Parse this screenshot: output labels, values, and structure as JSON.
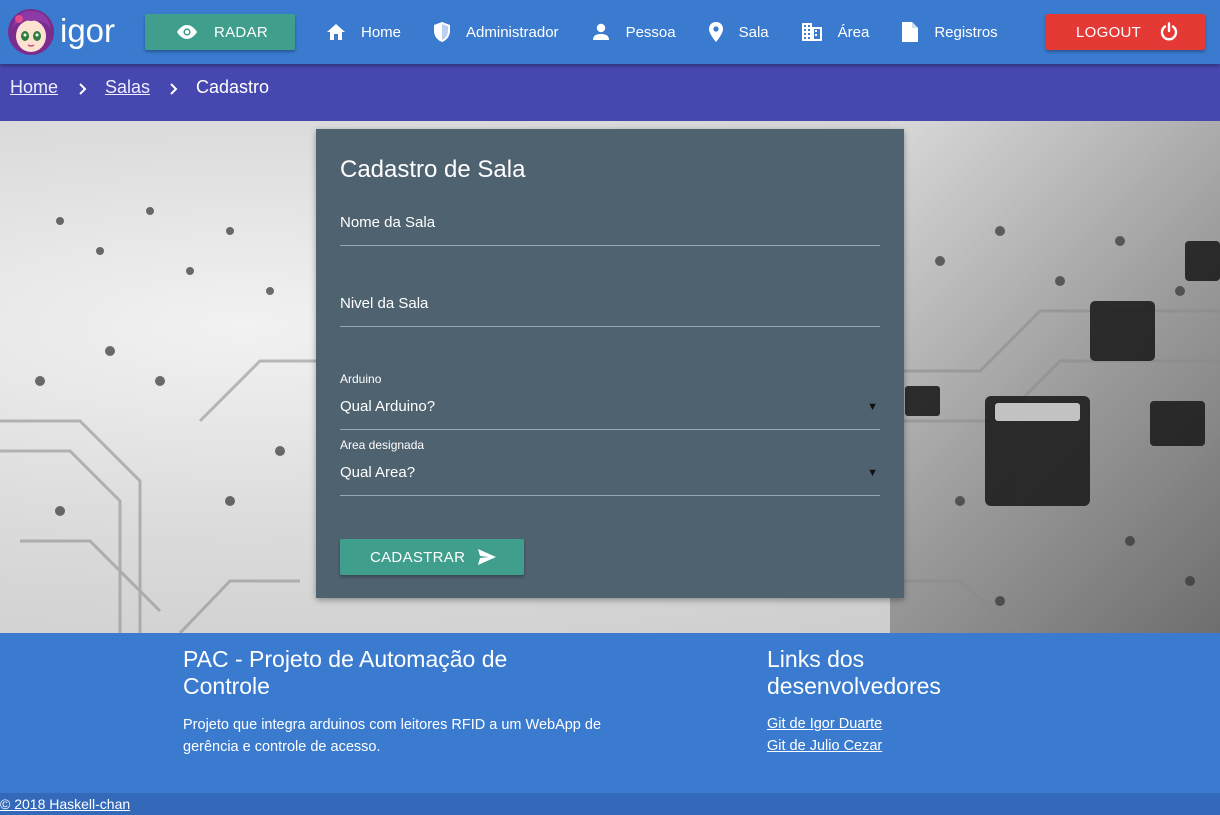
{
  "navbar": {
    "brand": "igor",
    "radar_label": "RADAR",
    "items": [
      {
        "label": "Home",
        "icon": "home-icon"
      },
      {
        "label": "Administrador",
        "icon": "shield-icon"
      },
      {
        "label": "Pessoa",
        "icon": "person-icon"
      },
      {
        "label": "Sala",
        "icon": "location-pin-icon"
      },
      {
        "label": "Área",
        "icon": "building-icon"
      },
      {
        "label": "Registros",
        "icon": "document-icon"
      }
    ],
    "logout_label": "LOGOUT"
  },
  "breadcrumb": {
    "home": "Home",
    "salas": "Salas",
    "current": "Cadastro"
  },
  "form": {
    "title": "Cadastro de Sala",
    "nome_label": "Nome da Sala",
    "nivel_label": "Nivel da Sala",
    "arduino_label": "Arduino",
    "arduino_value": "Qual Arduino?",
    "area_label": "Area designada",
    "area_value": "Qual Area?",
    "submit_label": "CADASTRAR"
  },
  "footer": {
    "title": "PAC - Projeto de Automação de Controle",
    "description": "Projeto que integra arduinos com leitores RFID a um WebApp de gerência e controle de acesso.",
    "links_title": "Links dos desenvolvedores",
    "link1": "Git de Igor Duarte",
    "link2": "Git de Julio Cezar",
    "copyright": "© 2018 Haskell-chan"
  },
  "colors": {
    "navbar": "#3a7bd0",
    "breadcrumb": "#4747b0",
    "card": "#4f6270",
    "teal": "#3f9e8c",
    "logout": "#e53935"
  }
}
